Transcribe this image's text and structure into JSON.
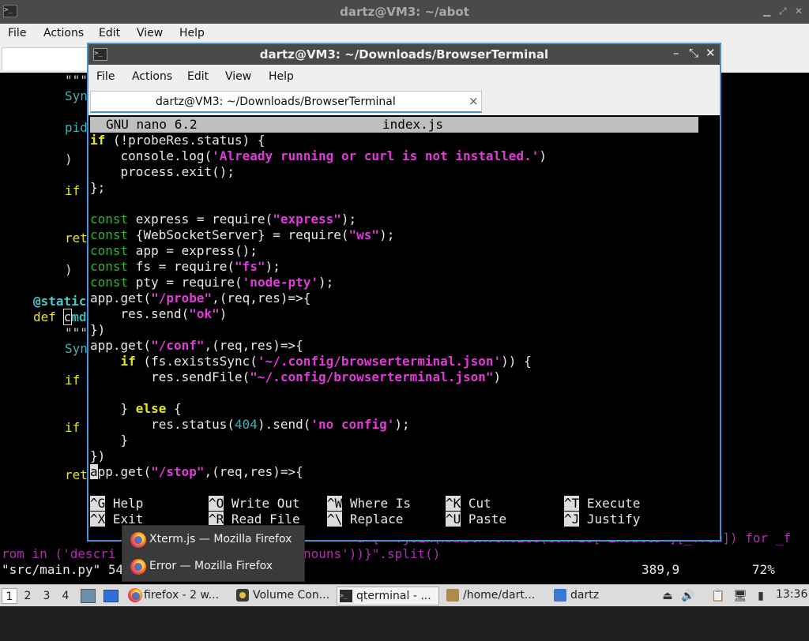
{
  "bg_window": {
    "title": "dartz@VM3: ~/abot",
    "menu": [
      "File",
      "Actions",
      "Edit",
      "View",
      "Help"
    ],
    "code": {
      "l1": "\"\"\"",
      "l2": "Syn",
      "l3": "pid",
      "l4": ")",
      "l5": "if",
      "l6": "ret",
      "l7": ")",
      "l8_dec": "@static",
      "l9_kw": "def",
      "l9_cursor": "c",
      "l9_rest": "md",
      "l10": "\"\"\"",
      "l11": "Syn",
      "l12": "if",
      "l13": "if",
      "l14": "ret",
      "frag_right": "a [  .join(RANDOM.choice(CONFIG[ insults ][_from]) for _f",
      "wrap_line": "rom in ('descri",
      "wrap_tail": "nouns'))}\".split()",
      "status_file": "\"src/main.py\" 54",
      "status_pos": "389,9",
      "status_pct": "72%"
    }
  },
  "fg_window": {
    "title": "dartz@VM3: ~/Downloads/BrowserTerminal",
    "menu": [
      "File",
      "Actions",
      "Edit",
      "View",
      "Help"
    ],
    "tab_label": "dartz@VM3: ~/Downloads/BrowserTerminal",
    "tab_close": "×",
    "nano": {
      "version": "GNU nano 6.2",
      "filename": "index.js"
    },
    "code": {
      "c1a": "if",
      "c1b": " (!probeRes.status) {",
      "c2a": "    console.log(",
      "c2b": "'Already running or curl is not installed.'",
      "c2c": ")",
      "c3": "    process.exit();",
      "c4": "};",
      "c6k": "const",
      "c6a": " express = require(",
      "c6s": "\"express\"",
      "c6b": ");",
      "c7k": "const",
      "c7a": " {WebSocketServer} = require(",
      "c7s": "\"ws\"",
      "c7b": ");",
      "c8k": "const",
      "c8a": " app = express();",
      "c9k": "const",
      "c9a": " fs = require(",
      "c9s": "\"fs\"",
      "c9b": ");",
      "c10k": "const",
      "c10a": " pty = require(",
      "c10s": "'node-pty'",
      "c10b": ");",
      "c11a": "app.get(",
      "c11s": "\"/probe\"",
      "c11b": ",(req,res)=>{",
      "c12a": "    res.send(",
      "c12s": "\"ok\"",
      "c12b": ")",
      "c13": "})",
      "c14a": "app.get(",
      "c14s": "\"/conf\"",
      "c14b": ",(req,res)=>{",
      "c15i": "    if",
      "c15a": " (fs.existsSync(",
      "c15s": "'~/.config/browserterminal.json'",
      "c15b": ")) {",
      "c16a": "        res.sendFile(",
      "c16s": "\"~/.config/browserterminal.json\"",
      "c16b": ")",
      "c18a": "    } ",
      "c18i": "else",
      "c18b": " {",
      "c19a": "        res.status(",
      "c19n": "404",
      "c19b": ").send(",
      "c19s": "'no config'",
      "c19c": ");",
      "c20": "    }",
      "c21": "})",
      "c22cur": "a",
      "c22a": "pp.get(",
      "c22s": "\"/stop\"",
      "c22b": ",(req,res)=>{"
    },
    "shortcuts": [
      {
        "key": "^G",
        "label": "Help"
      },
      {
        "key": "^O",
        "label": "Write Out"
      },
      {
        "key": "^W",
        "label": "Where Is"
      },
      {
        "key": "^K",
        "label": "Cut"
      },
      {
        "key": "^T",
        "label": "Execute"
      },
      {
        "key": "^X",
        "label": "Exit"
      },
      {
        "key": "^R",
        "label": "Read File"
      },
      {
        "key": "^\\",
        "label": "Replace"
      },
      {
        "key": "^U",
        "label": "Paste"
      },
      {
        "key": "^J",
        "label": "Justify"
      }
    ]
  },
  "popup": {
    "items": [
      "Xterm.js — Mozilla Firefox",
      "Error — Mozilla Firefox"
    ]
  },
  "taskbar": {
    "workspaces": [
      "1",
      "2",
      "3",
      "4"
    ],
    "tasks": [
      "firefox - 2 w...",
      "Volume Con...",
      "qterminal - ...",
      "/home/dart...",
      "dartz"
    ],
    "clock": "13:36"
  },
  "colors": {
    "accent": "#4a90d9",
    "nano_keyword": "#2fb32f",
    "nano_string": "#e03ad8",
    "nano_if": "#e6e61e",
    "nano_number": "#3fb1b1"
  }
}
